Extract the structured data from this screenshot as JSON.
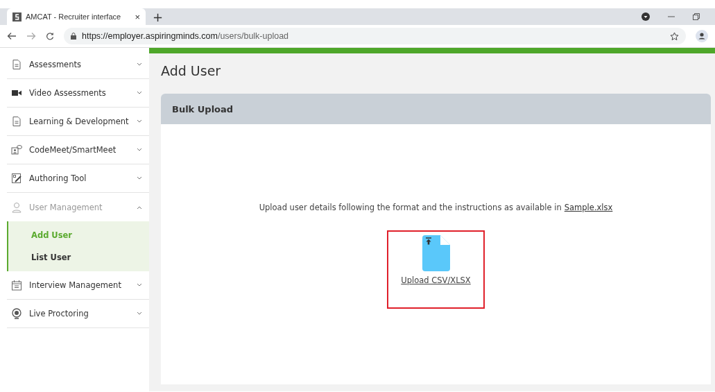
{
  "browser": {
    "tab_title": "AMCAT - Recruiter interface",
    "tab_close": "×",
    "new_tab": "+",
    "url_host": "https://employer.aspiringminds.com",
    "url_path": "/users/bulk-upload"
  },
  "sidebar": {
    "items": [
      {
        "label": "Assessments",
        "expanded": false
      },
      {
        "label": "Video Assessments",
        "expanded": false
      },
      {
        "label": "Learning & Development",
        "expanded": false
      },
      {
        "label": "CodeMeet/SmartMeet",
        "expanded": false
      },
      {
        "label": "Authoring Tool",
        "expanded": false
      },
      {
        "label": "User Management",
        "expanded": true,
        "children": [
          {
            "label": "Add User",
            "selected": true
          },
          {
            "label": "List User",
            "selected": false
          }
        ]
      },
      {
        "label": "Interview Management",
        "expanded": false
      },
      {
        "label": "Live Proctoring",
        "expanded": false
      }
    ]
  },
  "page": {
    "title": "Add User",
    "panel": {
      "title": "Bulk Upload",
      "instructions": "Upload user details following the format and the instructions as available in",
      "sample_link": "Sample.xlsx",
      "upload_label": "Upload CSV/XLSX",
      "highlighted": true
    }
  }
}
